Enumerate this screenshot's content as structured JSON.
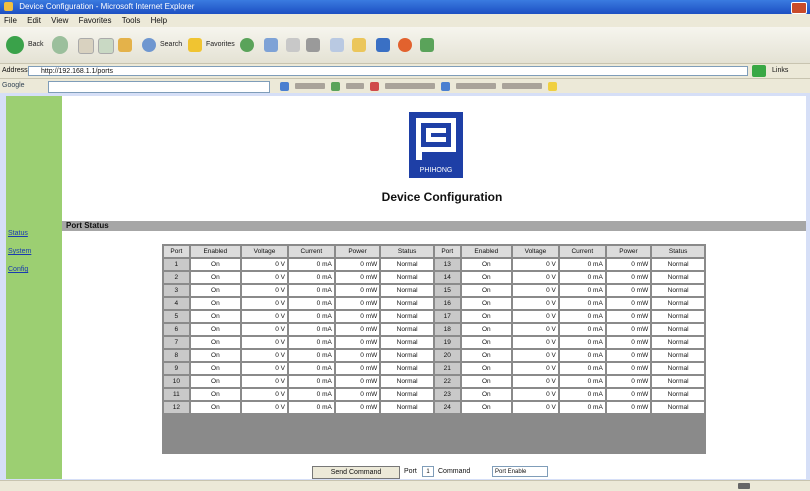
{
  "window": {
    "title": "Device Configuration - Microsoft Internet Explorer"
  },
  "menu": [
    "File",
    "Edit",
    "View",
    "Favorites",
    "Tools",
    "Help"
  ],
  "toolbar": {
    "back_label": "Back",
    "search_label": "Search",
    "favorites_label": "Favorites"
  },
  "address": {
    "label": "Address",
    "value": "http://192.168.1.1/ports",
    "go_label": "Go",
    "links_label": "Links"
  },
  "google": {
    "label": "Google",
    "value": ""
  },
  "sidebar": {
    "items": [
      {
        "label": "Status"
      },
      {
        "label": "System"
      },
      {
        "label": "Config"
      }
    ]
  },
  "logo": {
    "brand": "PHIHONG"
  },
  "page": {
    "title": "Device Configuration",
    "section": "Port Status"
  },
  "colors": {
    "sidebar": "#9ccf72",
    "titlebar": "#1d4fc2",
    "logo": "#1e3fa6"
  },
  "table": {
    "headers": [
      "Port",
      "Enabled",
      "Voltage",
      "Current",
      "Power",
      "Status"
    ],
    "left": [
      {
        "port": "1",
        "enabled": "On",
        "voltage": "0 V",
        "current": "0 mA",
        "power": "0 mW",
        "status": "Normal"
      },
      {
        "port": "2",
        "enabled": "On",
        "voltage": "0 V",
        "current": "0 mA",
        "power": "0 mW",
        "status": "Normal"
      },
      {
        "port": "3",
        "enabled": "On",
        "voltage": "0 V",
        "current": "0 mA",
        "power": "0 mW",
        "status": "Normal"
      },
      {
        "port": "4",
        "enabled": "On",
        "voltage": "0 V",
        "current": "0 mA",
        "power": "0 mW",
        "status": "Normal"
      },
      {
        "port": "5",
        "enabled": "On",
        "voltage": "0 V",
        "current": "0 mA",
        "power": "0 mW",
        "status": "Normal"
      },
      {
        "port": "6",
        "enabled": "On",
        "voltage": "0 V",
        "current": "0 mA",
        "power": "0 mW",
        "status": "Normal"
      },
      {
        "port": "7",
        "enabled": "On",
        "voltage": "0 V",
        "current": "0 mA",
        "power": "0 mW",
        "status": "Normal"
      },
      {
        "port": "8",
        "enabled": "On",
        "voltage": "0 V",
        "current": "0 mA",
        "power": "0 mW",
        "status": "Normal"
      },
      {
        "port": "9",
        "enabled": "On",
        "voltage": "0 V",
        "current": "0 mA",
        "power": "0 mW",
        "status": "Normal"
      },
      {
        "port": "10",
        "enabled": "On",
        "voltage": "0 V",
        "current": "0 mA",
        "power": "0 mW",
        "status": "Normal"
      },
      {
        "port": "11",
        "enabled": "On",
        "voltage": "0 V",
        "current": "0 mA",
        "power": "0 mW",
        "status": "Normal"
      },
      {
        "port": "12",
        "enabled": "On",
        "voltage": "0 V",
        "current": "0 mA",
        "power": "0 mW",
        "status": "Normal"
      }
    ],
    "right": [
      {
        "port": "13",
        "enabled": "On",
        "voltage": "0 V",
        "current": "0 mA",
        "power": "0 mW",
        "status": "Normal"
      },
      {
        "port": "14",
        "enabled": "On",
        "voltage": "0 V",
        "current": "0 mA",
        "power": "0 mW",
        "status": "Normal"
      },
      {
        "port": "15",
        "enabled": "On",
        "voltage": "0 V",
        "current": "0 mA",
        "power": "0 mW",
        "status": "Normal"
      },
      {
        "port": "16",
        "enabled": "On",
        "voltage": "0 V",
        "current": "0 mA",
        "power": "0 mW",
        "status": "Normal"
      },
      {
        "port": "17",
        "enabled": "On",
        "voltage": "0 V",
        "current": "0 mA",
        "power": "0 mW",
        "status": "Normal"
      },
      {
        "port": "18",
        "enabled": "On",
        "voltage": "0 V",
        "current": "0 mA",
        "power": "0 mW",
        "status": "Normal"
      },
      {
        "port": "19",
        "enabled": "On",
        "voltage": "0 V",
        "current": "0 mA",
        "power": "0 mW",
        "status": "Normal"
      },
      {
        "port": "20",
        "enabled": "On",
        "voltage": "0 V",
        "current": "0 mA",
        "power": "0 mW",
        "status": "Normal"
      },
      {
        "port": "21",
        "enabled": "On",
        "voltage": "0 V",
        "current": "0 mA",
        "power": "0 mW",
        "status": "Normal"
      },
      {
        "port": "22",
        "enabled": "On",
        "voltage": "0 V",
        "current": "0 mA",
        "power": "0 mW",
        "status": "Normal"
      },
      {
        "port": "23",
        "enabled": "On",
        "voltage": "0 V",
        "current": "0 mA",
        "power": "0 mW",
        "status": "Normal"
      },
      {
        "port": "24",
        "enabled": "On",
        "voltage": "0 V",
        "current": "0 mA",
        "power": "0 mW",
        "status": "Normal"
      }
    ]
  },
  "controls": {
    "send_label": "Send Command",
    "port_label": "Port",
    "port_value": "1",
    "command_label": "Command",
    "command_value": "Port Enable"
  }
}
